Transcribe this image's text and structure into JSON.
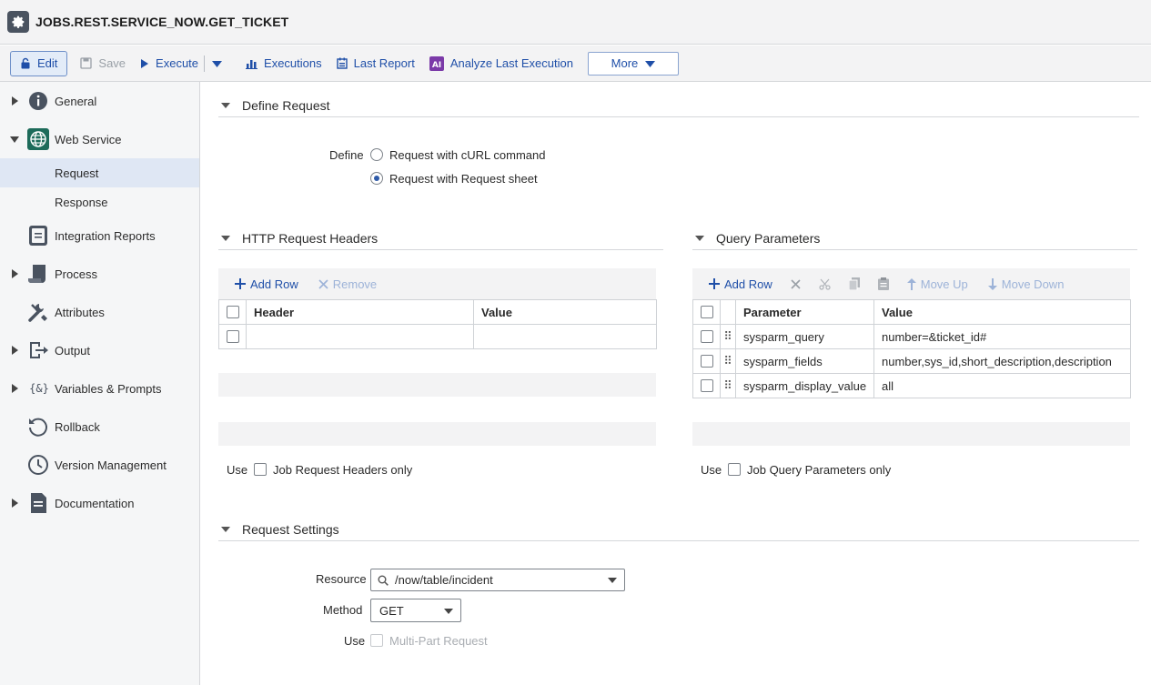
{
  "window": {
    "title": "JOBS.REST.SERVICE_NOW.GET_TICKET"
  },
  "toolbar": {
    "edit": "Edit",
    "save": "Save",
    "execute": "Execute",
    "executions": "Executions",
    "last_report": "Last Report",
    "analyze": "Analyze Last Execution",
    "more": "More"
  },
  "sidebar": {
    "items": [
      {
        "label": "General"
      },
      {
        "label": "Web Service"
      },
      {
        "label": "Integration Reports"
      },
      {
        "label": "Process"
      },
      {
        "label": "Attributes"
      },
      {
        "label": "Output"
      },
      {
        "label": "Variables & Prompts"
      },
      {
        "label": "Rollback"
      },
      {
        "label": "Version Management"
      },
      {
        "label": "Documentation"
      }
    ],
    "sub": {
      "request": "Request",
      "response": "Response"
    }
  },
  "define": {
    "section": "Define Request",
    "label": "Define",
    "option_curl": "Request with cURL command",
    "option_sheet": "Request with Request sheet",
    "selected": "Request with Request sheet"
  },
  "headers": {
    "section": "HTTP Request Headers",
    "add_row": "Add Row",
    "remove": "Remove",
    "col_header": "Header",
    "col_value": "Value",
    "use_label": "Use",
    "use_option": "Job Request Headers only"
  },
  "query": {
    "section": "Query Parameters",
    "add_row": "Add Row",
    "move_up": "Move Up",
    "move_down": "Move Down",
    "col_param": "Parameter",
    "col_value": "Value",
    "rows": [
      {
        "param": "sysparm_query",
        "value": "number=&ticket_id#"
      },
      {
        "param": "sysparm_fields",
        "value": "number,sys_id,short_description,description"
      },
      {
        "param": "sysparm_display_value",
        "value": "all"
      }
    ],
    "use_label": "Use",
    "use_option": "Job Query Parameters only"
  },
  "settings": {
    "section": "Request Settings",
    "resource_label": "Resource",
    "resource_value": "/now/table/incident",
    "method_label": "Method",
    "method_value": "GET",
    "use_label": "Use",
    "multipart": "Multi-Part Request"
  },
  "colors": {
    "accent": "#1f4fa8",
    "selected_bg": "#dfe7f4",
    "panel_bg": "#f3f3f4"
  }
}
